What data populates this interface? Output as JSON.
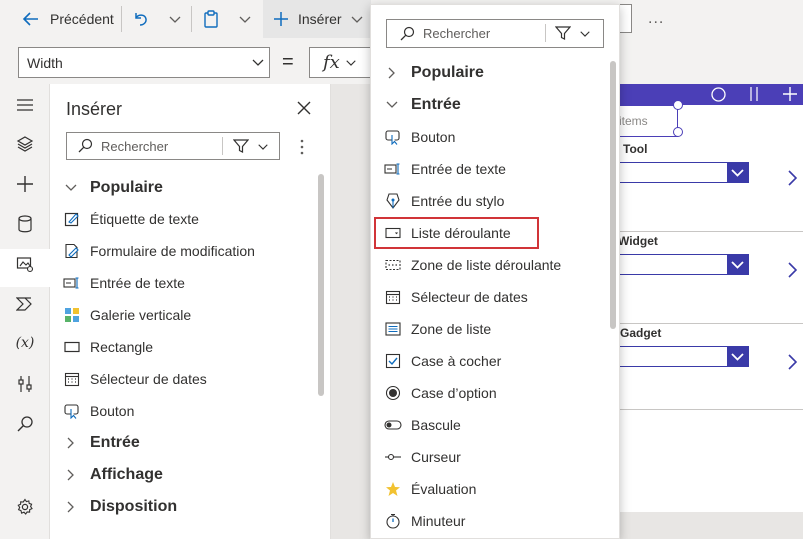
{
  "toolbar": {
    "back_label": "Précédent",
    "insert_label": "Insérer",
    "more_label": "..."
  },
  "formula": {
    "property": "Width",
    "equals": "=",
    "fx": "fx"
  },
  "pane": {
    "title": "Insérer",
    "search_placeholder": "Rechercher",
    "groups": {
      "popular": "Populaire",
      "input": "Entrée",
      "display": "Affichage",
      "layout": "Disposition"
    },
    "items": [
      {
        "label": "Étiquette de texte",
        "icon": "text-label-icon"
      },
      {
        "label": "Formulaire de modification",
        "icon": "edit-form-icon"
      },
      {
        "label": "Entrée de texte",
        "icon": "text-input-icon"
      },
      {
        "label": "Galerie verticale",
        "icon": "gallery-icon"
      },
      {
        "label": "Rectangle",
        "icon": "rectangle-icon"
      },
      {
        "label": "Sélecteur de dates",
        "icon": "calendar-icon"
      },
      {
        "label": "Bouton",
        "icon": "button-icon"
      }
    ]
  },
  "menu": {
    "search_placeholder": "Rechercher",
    "groups": {
      "popular": "Populaire",
      "input": "Entrée"
    },
    "items": [
      {
        "label": "Bouton",
        "icon": "button-icon"
      },
      {
        "label": "Entrée de texte",
        "icon": "text-input-icon"
      },
      {
        "label": "Entrée du stylo",
        "icon": "pen-icon"
      },
      {
        "label": "Liste déroulante",
        "icon": "dropdown-icon"
      },
      {
        "label": "Zone de liste déroulante",
        "icon": "combobox-icon"
      },
      {
        "label": "Sélecteur de dates",
        "icon": "calendar-icon"
      },
      {
        "label": "Zone de liste",
        "icon": "listbox-icon"
      },
      {
        "label": "Case à cocher",
        "icon": "checkbox-icon"
      },
      {
        "label": "Case d’option",
        "icon": "radio-icon"
      },
      {
        "label": "Bascule",
        "icon": "toggle-icon"
      },
      {
        "label": "Curseur",
        "icon": "slider-icon"
      },
      {
        "label": "Évaluation",
        "icon": "star-icon"
      },
      {
        "label": "Minuteur",
        "icon": "timer-icon"
      }
    ],
    "highlight_color": "#d13438"
  },
  "app": {
    "search_placeholder": "items",
    "rows": [
      {
        "title": "Tool"
      },
      {
        "title": "Widget"
      },
      {
        "title": "Gadget"
      }
    ],
    "header_color": "#4b3fb7",
    "dropdown_color": "#3a3aa8"
  },
  "colors": {
    "accent": "#0f6cbd",
    "toolbar_bg": "#f3f2f1"
  }
}
